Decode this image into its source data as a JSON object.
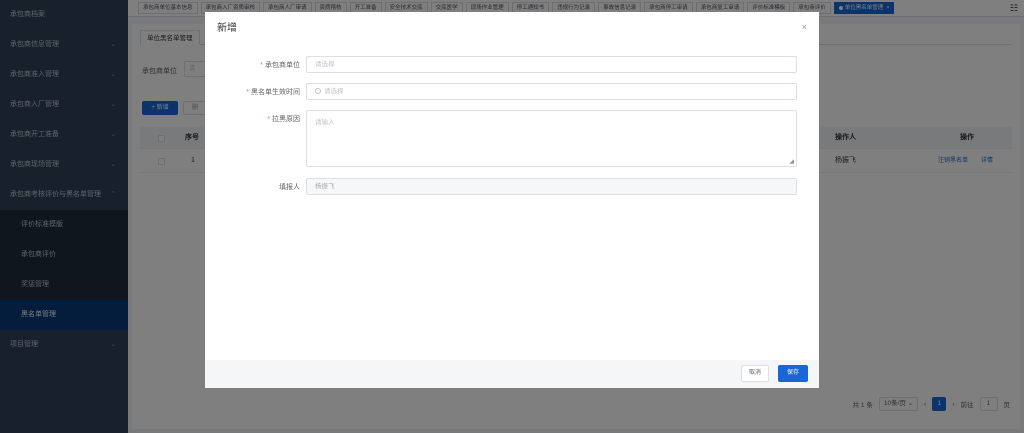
{
  "sidebar": {
    "items": [
      {
        "label": "承包商档案",
        "chevron": ""
      },
      {
        "label": "承包商信息管理",
        "chevron": "⌄"
      },
      {
        "label": "承包商准入管理",
        "chevron": "⌄"
      },
      {
        "label": "承包商入厂管理",
        "chevron": "⌄"
      },
      {
        "label": "承包商开工准备",
        "chevron": "⌄"
      },
      {
        "label": "承包商现场管理",
        "chevron": "⌄"
      },
      {
        "label": "承包商考核评价与黑名单管理",
        "chevron": "⌃"
      }
    ],
    "sub_items": [
      {
        "label": "评价标准模版"
      },
      {
        "label": "承包商评价"
      },
      {
        "label": "奖惩管理"
      },
      {
        "label": "黑名单管理"
      }
    ],
    "bottom_item": {
      "label": "项目管理",
      "chevron": "⌄"
    }
  },
  "tabs": [
    "承包商单位基本信息",
    "承包商入厂资质审核",
    "承包商人厂审请",
    "资质稽核",
    "开工准备",
    "安全技术交底",
    "交底医学",
    "现场作业管理",
    "停工通知书",
    "违规行为记录",
    "事故信息记录",
    "承包商停工审请",
    "承包商复工审请",
    "评价标准模板",
    "承包商评价"
  ],
  "active_tab": {
    "label": "单位黑名单管理",
    "close": "×"
  },
  "tab_menu_icon": "grid-icon",
  "page": {
    "inner_tab": "单位黑名单管理",
    "filter_label": "承包商单位",
    "filter_placeholder": "请",
    "add_button": "+ 新增",
    "delete_button": "删"
  },
  "table": {
    "columns": {
      "index": "序号",
      "operator": "操作人",
      "action": "操作"
    },
    "rows": [
      {
        "index": "1",
        "operator": "杨振飞",
        "action_remove": "注销黑名单",
        "action_detail": "详情"
      }
    ]
  },
  "pagination": {
    "total": "共 1 条",
    "page_size": "10条/页",
    "prev": "‹",
    "current": "1",
    "next": "›",
    "goto_label": "前往",
    "goto_value": "1",
    "page_unit": "页"
  },
  "dialog": {
    "title": "新增",
    "close": "×",
    "fields": {
      "unit_label": "承包商单位",
      "unit_placeholder": "请选择",
      "time_label": "黑名单生效时间",
      "time_placeholder": "请选择",
      "reason_label": "拉黑原因",
      "reason_placeholder": "请输入",
      "reporter_label": "填报人",
      "reporter_value": "杨振飞"
    },
    "required_mark": "*",
    "cancel_button": "取消",
    "save_button": "保存"
  },
  "colors": {
    "primary": "#1966d6",
    "sidebar_bg": "#304156",
    "sidebar_active": "#0a3a78",
    "required": "#f56c6c"
  }
}
